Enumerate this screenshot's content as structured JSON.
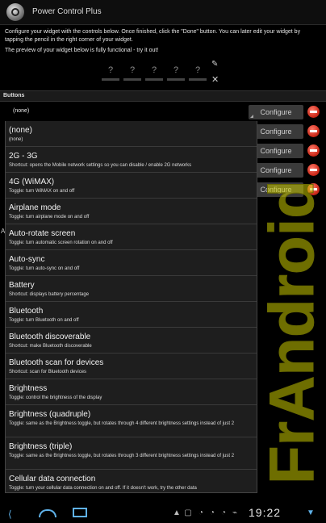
{
  "app": {
    "title": "Power Control Plus"
  },
  "intro": {
    "instructions": "Configure your widget with the controls below. Once finished, click the \"Done\" button. You can later edit your widget by tapping the pencil in the right corner of your widget.",
    "preview_note": "The preview of your widget below is fully functional - try it out!"
  },
  "widget_preview": {
    "slots": [
      "?",
      "?",
      "?",
      "?",
      "?"
    ]
  },
  "buttons_section": {
    "header": "Buttons",
    "selected_value": "(none)",
    "configure_label": "Configure",
    "configure_rows": 5
  },
  "side_letter": "A",
  "dropdown": {
    "options": [
      {
        "name": "(none)",
        "desc": "(none)"
      },
      {
        "name": "2G - 3G",
        "desc": "Shortcut: opens the Mobile network settings so you can disable / enable 2G networks"
      },
      {
        "name": "4G (WiMAX)",
        "desc": "Toggle: turn WiMAX on and off"
      },
      {
        "name": "Airplane mode",
        "desc": "Toggle: turn airplane mode on and off"
      },
      {
        "name": "Auto-rotate screen",
        "desc": "Toggle: turn automatic screen rotation on and off"
      },
      {
        "name": "Auto-sync",
        "desc": "Toggle: turn auto-sync on and off"
      },
      {
        "name": "Battery",
        "desc": "Shortcut: displays battery percentage"
      },
      {
        "name": "Bluetooth",
        "desc": "Toggle: turn Bluetooth on and off"
      },
      {
        "name": "Bluetooth discoverable",
        "desc": "Shortcut: make Bluetooth discoverable"
      },
      {
        "name": "Bluetooth scan for devices",
        "desc": "Shortcut: scan for Bluetooth devices"
      },
      {
        "name": "Brightness",
        "desc": "Toggle: control the brightness of the display"
      },
      {
        "name": "Brightness (quadruple)",
        "desc": "Toggle: same as the Brightness toggle, but rotates through 4 different brightness settings instead of just 2"
      },
      {
        "name": "Brightness (triple)",
        "desc": "Toggle: same as the Brightness toggle, but rotates through 3 different brightness settings instead of just 2"
      },
      {
        "name": "Cellular data connection",
        "desc": "Toggle: turn your cellular data connection on and off. If it doesn't work, try the other data"
      }
    ]
  },
  "watermark": {
    "text": "FrAndroid",
    "color": "#c8c800"
  },
  "status_bar": {
    "time": "19:22",
    "accent": "#5fb1e8"
  }
}
